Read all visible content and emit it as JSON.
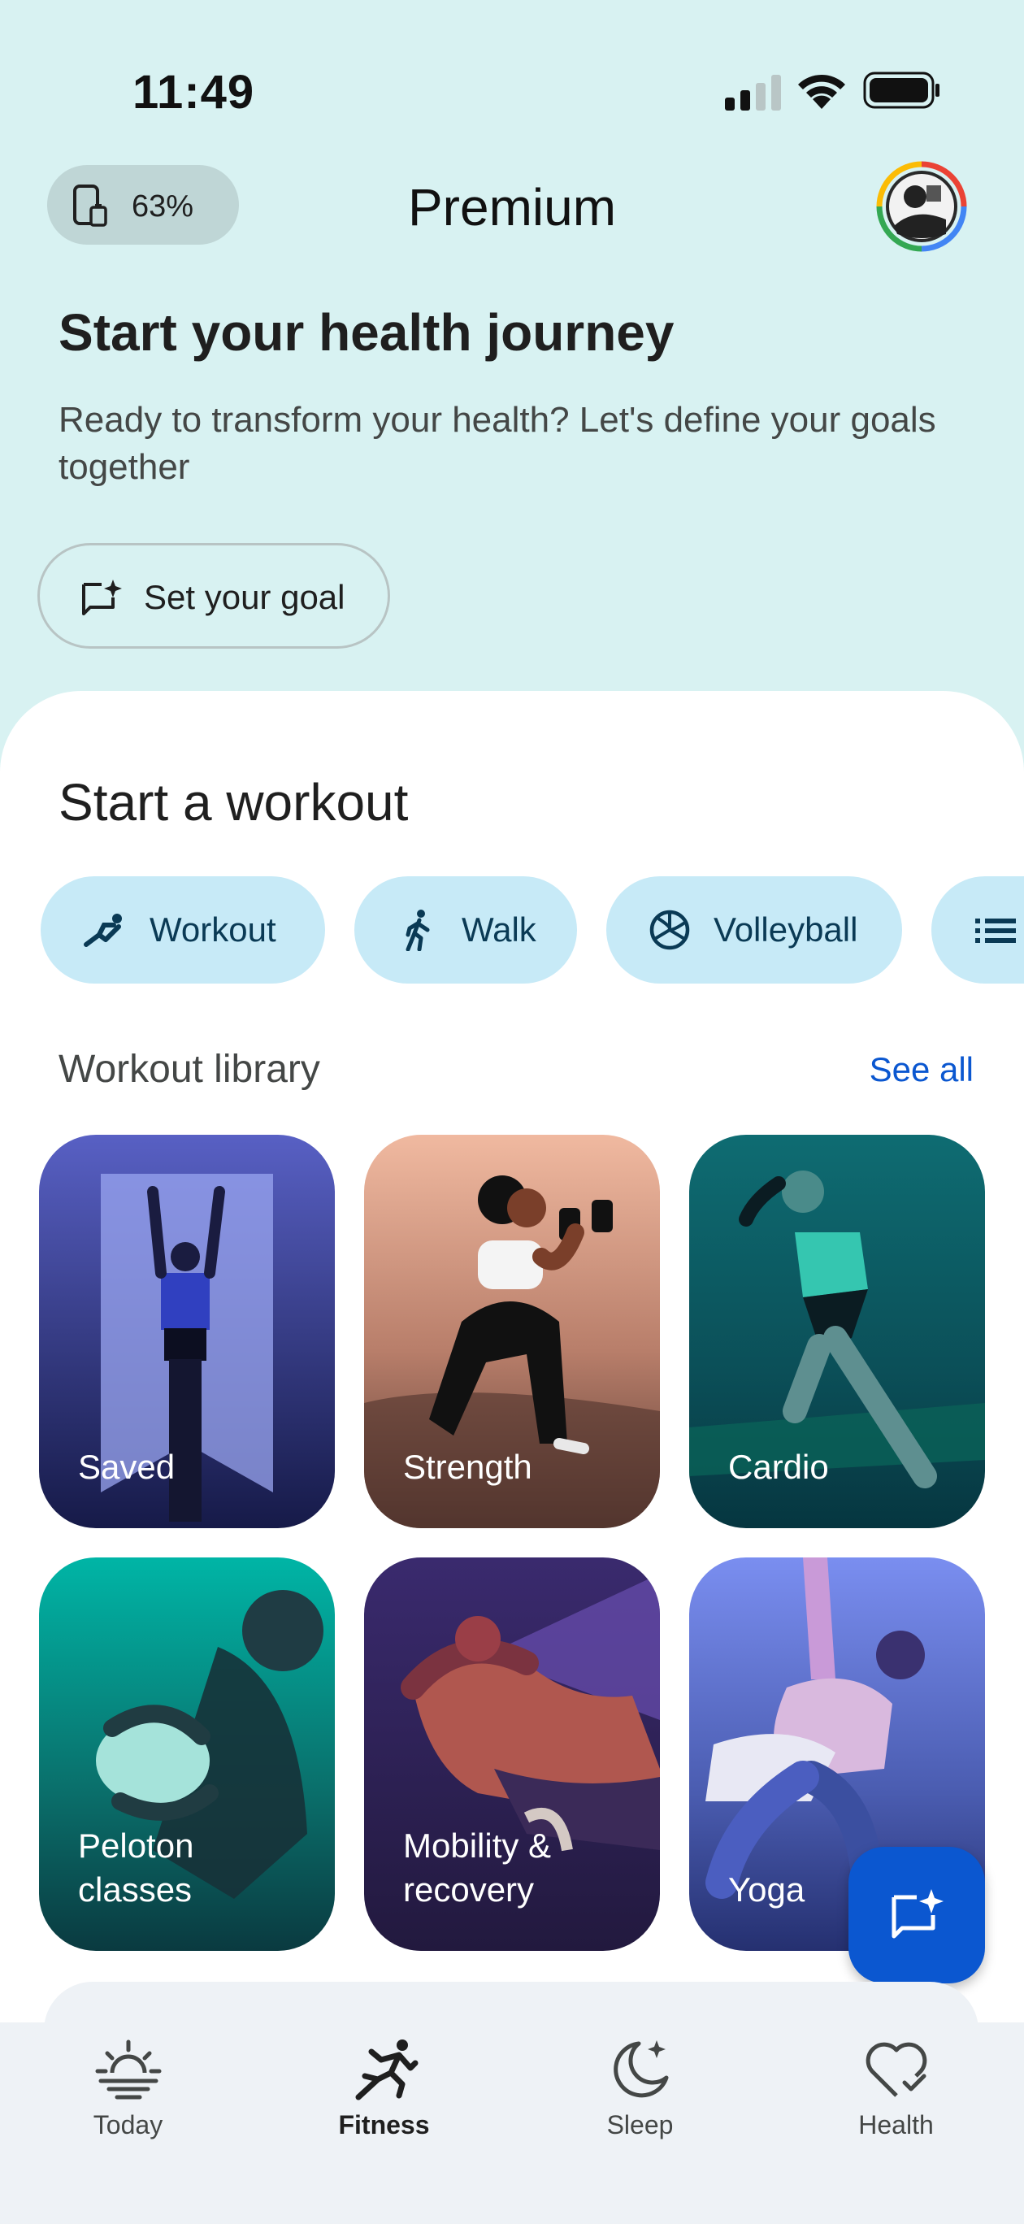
{
  "status_bar": {
    "time": "11:49"
  },
  "header": {
    "battery_percent": "63%",
    "title": "Premium"
  },
  "intro": {
    "heading": "Start your health journey",
    "subtitle": "Ready to transform your health? Let's define your goals together",
    "goal_button": "Set your goal"
  },
  "workout": {
    "heading": "Start a workout",
    "chips": [
      {
        "label": "Workout",
        "icon": "workout-icon"
      },
      {
        "label": "Walk",
        "icon": "walk-icon"
      },
      {
        "label": "Volleyball",
        "icon": "volleyball-icon"
      },
      {
        "label": "",
        "icon": "list-icon"
      }
    ]
  },
  "library": {
    "heading": "Workout library",
    "see_all": "See all",
    "cards": [
      {
        "label": "Saved"
      },
      {
        "label": "Strength"
      },
      {
        "label": "Cardio"
      },
      {
        "label": "Peloton classes"
      },
      {
        "label": "Mobility & recovery"
      },
      {
        "label": "Yoga"
      }
    ]
  },
  "bottom_nav": {
    "items": [
      {
        "label": "Today",
        "icon": "sunrise-icon"
      },
      {
        "label": "Fitness",
        "icon": "running-icon"
      },
      {
        "label": "Sleep",
        "icon": "moon-icon"
      },
      {
        "label": "Health",
        "icon": "heart-check-icon"
      }
    ],
    "active": "Fitness"
  },
  "colors": {
    "background": "#d8f2f2",
    "chip": "#c7eaf7",
    "accent": "#0b57d0"
  }
}
